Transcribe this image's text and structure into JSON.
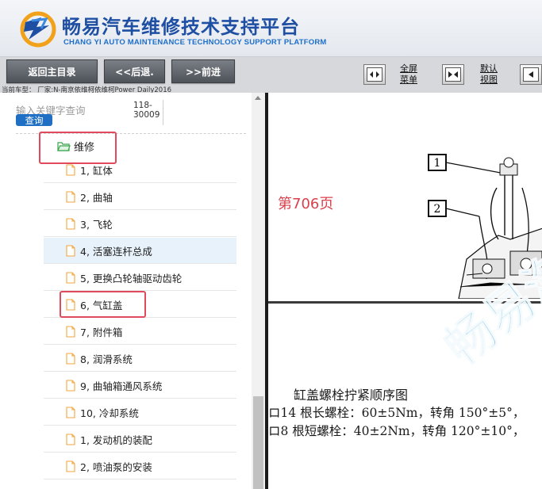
{
  "header": {
    "title_cn": "畅易汽车维修技术支持平台",
    "title_en": "CHANG YI AUTO MAINTENANCE TECHNOLOGY SUPPORT PLATFORM"
  },
  "toolbar": {
    "home_label": "返回主目录",
    "back_label": "<<后退.",
    "forward_label": ">>前进",
    "fullscreen_label_1": "全屏",
    "fullscreen_label_2": "菜单",
    "default_view_label_1": "默认",
    "default_view_label_2": "视图",
    "breadcrumb": "当前车型：  厂家:N-南京依维柯依维柯Power Daily2016"
  },
  "search": {
    "placeholder": "输入关键字查询",
    "button_label": "查询",
    "code_line_1": "118-",
    "code_line_2": "30009"
  },
  "tree": {
    "folder_label": "维修",
    "items": [
      {
        "label": "1, 缸体"
      },
      {
        "label": "2, 曲轴"
      },
      {
        "label": "3, 飞轮"
      },
      {
        "label": "4, 活塞连杆总成"
      },
      {
        "label": "5, 更换凸轮轴驱动齿轮"
      },
      {
        "label": "6, 气缸盖"
      },
      {
        "label": "7, 附件箱"
      },
      {
        "label": "8, 润滑系统"
      },
      {
        "label": "9, 曲轴箱通风系统"
      },
      {
        "label": "10, 冷却系统"
      },
      {
        "label": "1, 发动机的装配"
      },
      {
        "label": "2, 喷油泵的安装"
      }
    ]
  },
  "document": {
    "page_label": "第706页",
    "callout_1": "1",
    "callout_2": "2",
    "title": "缸盖螺栓拧紧顺序图",
    "line_1": "ロ14 根长螺栓：60±5Nm，转角 150°±5°，",
    "line_2": "ロ8 根短螺栓：40±2Nm，转角 120°±10°，",
    "watermark": "畅易汽"
  },
  "colors": {
    "brand_blue": "#1e4fa3",
    "highlight_red": "#e04a5c",
    "page_red": "#d8404c",
    "search_blue": "#1f6fc4"
  }
}
